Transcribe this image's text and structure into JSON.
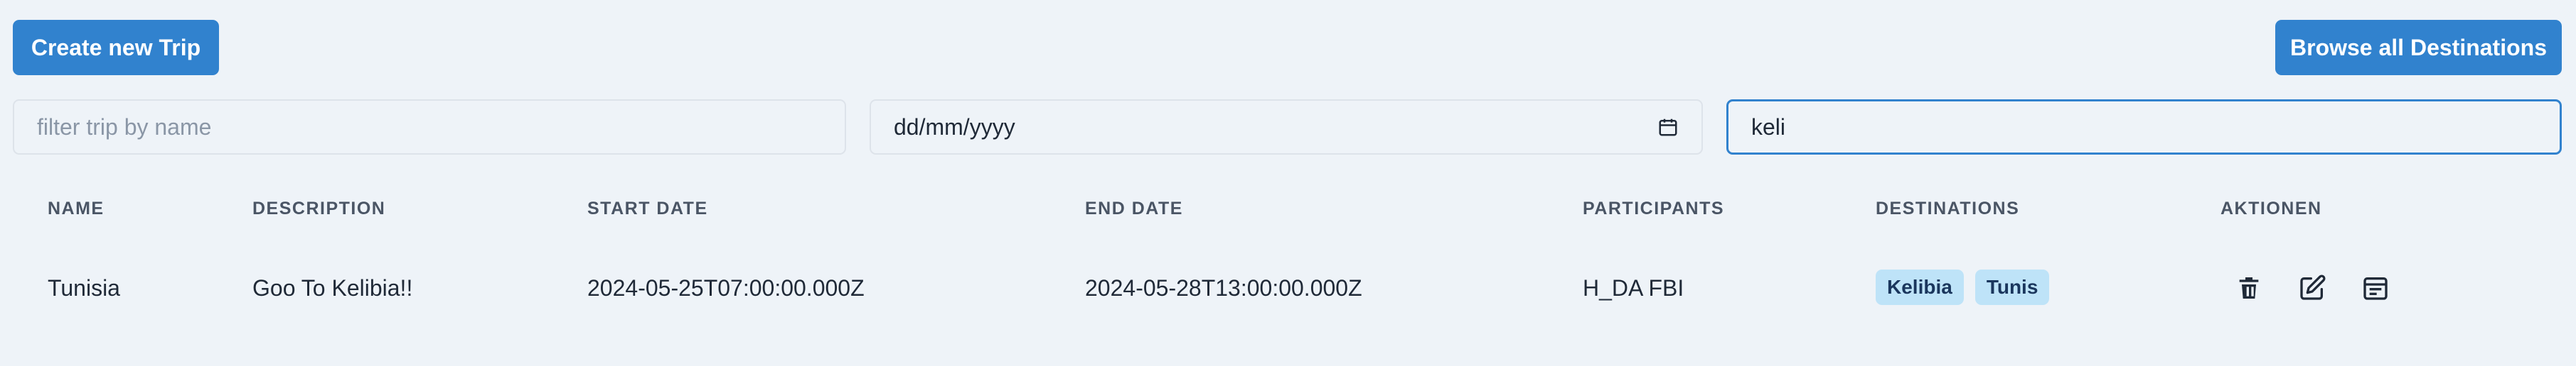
{
  "toolbar": {
    "create_label": "Create new Trip",
    "browse_label": "Browse all Destinations"
  },
  "filters": {
    "name_placeholder": "filter trip by name",
    "date_placeholder": "dd/mm/yyyy",
    "destination_value": "keli"
  },
  "table": {
    "headers": [
      "Name",
      "Description",
      "Start Date",
      "End Date",
      "Participants",
      "Destinations",
      "Aktionen"
    ],
    "rows": [
      {
        "name": "Tunisia",
        "description": "Goo To Kelibia!!",
        "start_date": "2024-05-25T07:00:00.000Z",
        "end_date": "2024-05-28T13:00:00.000Z",
        "participants": "H_DA FBI",
        "destinations": [
          "Kelibia",
          "Tunis"
        ]
      }
    ]
  },
  "icons": {
    "delete": "trash-icon",
    "edit": "edit-icon",
    "schedule": "calendar-icon",
    "date_picker": "calendar-icon"
  },
  "colors": {
    "primary": "#3182ce",
    "badge_bg": "#bee3f8",
    "page_bg": "#eef3f8"
  }
}
